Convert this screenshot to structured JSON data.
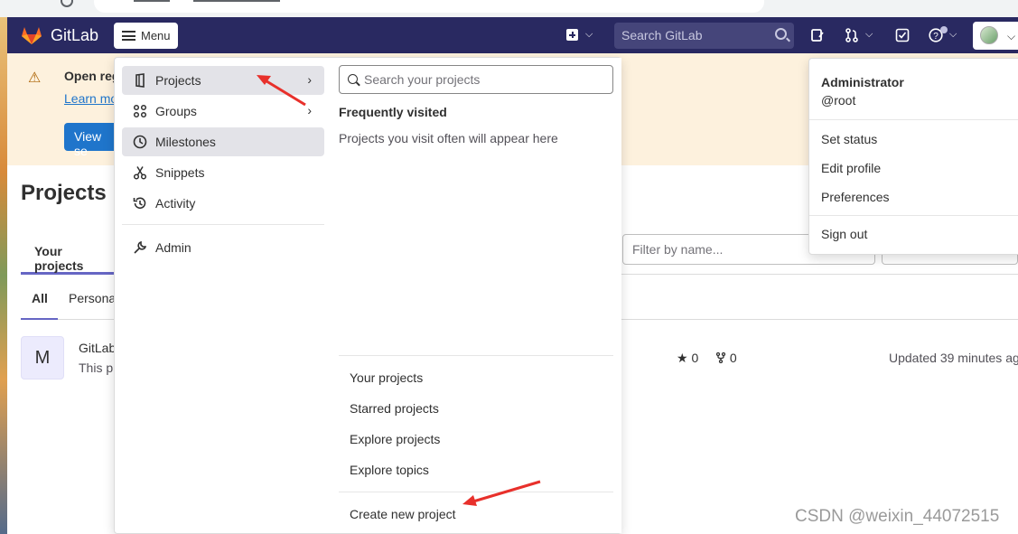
{
  "header": {
    "brand": "GitLab",
    "menu_label": "Menu",
    "search_placeholder": "Search GitLab"
  },
  "banner": {
    "title": "Open reg",
    "link": "Learn mo",
    "button": "View se"
  },
  "page": {
    "title": "Projects",
    "tab_active": "Your projects",
    "filter_placeholder": "Filter by name...",
    "subtab_all": "All",
    "subtab_personal": "Personal"
  },
  "project_row": {
    "avatar_letter": "M",
    "name": "GitLab",
    "desc": "This pr",
    "stars": "0",
    "forks": "0",
    "updated": "Updated 39 minutes ag"
  },
  "menu": {
    "items": [
      {
        "label": "Projects",
        "icon": "project-icon",
        "active": true,
        "chevron": true
      },
      {
        "label": "Groups",
        "icon": "group-icon",
        "active": false,
        "chevron": true
      },
      {
        "label": "Milestones",
        "icon": "clock-icon",
        "active": true,
        "chevron": false
      },
      {
        "label": "Snippets",
        "icon": "scissors-icon",
        "active": false,
        "chevron": false
      },
      {
        "label": "Activity",
        "icon": "history-icon",
        "active": false,
        "chevron": false
      }
    ],
    "admin": "Admin",
    "search_placeholder": "Search your projects",
    "frequent_title": "Frequently visited",
    "frequent_empty": "Projects you visit often will appear here",
    "links": [
      "Your projects",
      "Starred projects",
      "Explore projects",
      "Explore topics"
    ],
    "create": "Create new project"
  },
  "user_menu": {
    "name": "Administrator",
    "handle": "@root",
    "items": [
      "Set status",
      "Edit profile",
      "Preferences"
    ],
    "sign_out": "Sign out"
  },
  "watermark": "CSDN @weixin_44072515",
  "colors": {
    "header": "#292961",
    "accent": "#1f75cb",
    "annotation": "#e8302b"
  }
}
